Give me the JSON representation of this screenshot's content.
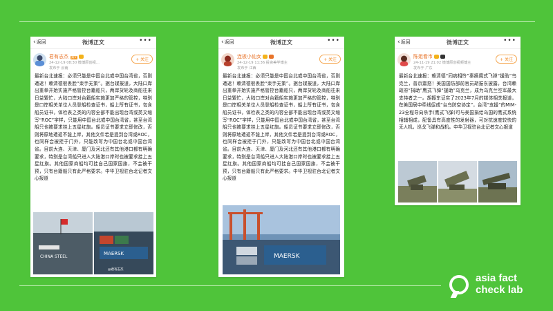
{
  "posts": [
    {
      "back": "返回",
      "title": "微博正文",
      "author": "君有志杰",
      "tag": "黄V",
      "time_line": "24-12-19 08:30   微博原创视…",
      "location": "发布于 云南",
      "follow": "+ 关注",
      "body": "最新台北速报：必须只能是中国台北或中国台湾省，否则遣返！赖清德很丢脸“束手无策”。据台媒报道，大陆口岸出重拳开始实施严格管控台籍船只，两岸货轮及商船往来日益繁忙，大陆口岸对台籍船实施更加严格的管控，特别是口岸相关单位人员登船检查证书，船上所有证书，包含船员证书，体检表之类的内容全部不能出现台湾或英文缩写“ROC”字样，只能用中国台北或中国台湾省，甚至台湾船只也被要求挂上五星红旗。船员证书要求立即修改，否则将原地遣返不能上岸，其他文件若是提到台湾或ROC，也同样会被拒于门外，只能改写为中国台北或中国台湾省。目前大连、天津、厦门及河北还有其他港口都有明确要求，特别是台湾船只进入大陆港口岸时也被要求挂上五星红旗。其他国家商船均可挂自己国家国旗，不会被干预，只有台籍船只有此严格要求。中华卫视驻台北记者文心报道",
      "watermark": "@君有志杰"
    },
    {
      "back": "返回",
      "title": "微博正文",
      "author": "连板小仙女",
      "tag": "",
      "time_line": "24-12-19 11:36   投资美学博主",
      "location": "发布于 江西",
      "follow": "+ 关注",
      "body": "最新台北速报：必须只能是中国台北或中国台湾省，否则遣返！赖清德很丢脸“束手无策”。据台媒报道，大陆口岸出重拳开始实施严格管控台籍船只，两岸货轮及商船往来日益繁忙，大陆口岸对台籍船实施更加严格的管控，特别是口岸相关单位人员登船检查证书，船上所有证书，包含船员证书，体检表之类的内容全部不能出现台湾或英文缩写“ROC”字样，只能用中国台北或中国台湾省，甚至台湾船只也被要求挂上五星红旗。船员证书要求立即修改，否则将原地遣返不能上岸，其他文件若是提到台湾或ROC，也同样会被拒于门外，只能改写为中国台北或中国台湾省。目前大连、天津、厦门及河北还有其他港口都有明确要求，特别是台湾船只进入大陆港口岸时也被要求挂上五星红旗。其他国家商船均可挂自己国家国旗，不会被干预，只有台籍船只有此严格要求。中华卫视驻台北记者文心报道"
    },
    {
      "back": "返回",
      "title": "微博正文",
      "author": "陈姐看市",
      "tag": "",
      "time_line": "24-11-19 21:02   微博原创视频博主",
      "location": "发布于 广东",
      "follow": "+ 关注",
      "body": "最新台北速报：赖清德“同病相怜”秦摘鹰式飞弹“援助”乌克兰，普京震怒！美国国防部前官员胡振东披露，台湾赖政府“捐助”鹰式飞弹“援助”乌克兰，成为乌克兰空军最大支持者之一。胡振东证实了2023年7月的媒体相关报道，在美国居中牵线促成“台乌防空协定”，台湾“支援”的MIM-23全程导向杀手(鹰式飞弹)可与美国捐给乌国的鹰式系统相辅相成，配备具有高度性的发射器，可对抗速度较快的无人机，巡戈飞弹和战机。中华卫视驻台北记者文心报道"
    }
  ],
  "logo": {
    "line1": "asia fact",
    "line2": "check lab"
  },
  "colors": {
    "background": "#4fc43a",
    "name": "#e8742a",
    "follow": "#f08a24"
  }
}
